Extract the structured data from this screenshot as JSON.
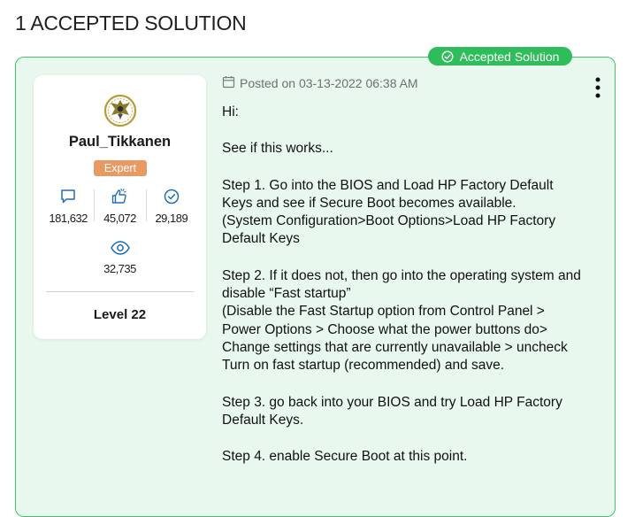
{
  "section": {
    "heading": "1 ACCEPTED SOLUTION"
  },
  "badge": {
    "label": "Accepted Solution",
    "icon": "check-circle-icon",
    "color": "#2ebd5a"
  },
  "colors": {
    "card_bg": "#e8f8ef",
    "card_border": "#3ec367",
    "rank_bg": "#e89a63"
  },
  "author": {
    "username": "Paul_Tikkanen",
    "avatar": "eagle-emblem-avatar",
    "rank": "Expert",
    "stats": [
      {
        "icon": "message-icon",
        "value": "181,632"
      },
      {
        "icon": "kudos-thumbs-up-icon",
        "value": "45,072"
      },
      {
        "icon": "check-circle-icon",
        "value": "29,189"
      }
    ],
    "views": {
      "icon": "eye-icon",
      "value": "32,735"
    },
    "level": "Level 22"
  },
  "post": {
    "posted": "Posted on 03-13-2022 06:38 AM",
    "menu_icon": "more-vertical-icon",
    "paragraphs": [
      "Hi:",
      "See if this works...",
      "Step 1. Go into the BIOS and Load HP Factory Default Keys and see if Secure Boot becomes available.\n(System Configuration>Boot Options>Load HP Factory Default Keys",
      "Step 2. If it does not, then go into the operating system and disable “Fast startup”\n(Disable the Fast Startup option from Control Panel > Power Options > Choose what the power buttons do> Change settings that are currently unavailable > uncheck Turn on fast startup (recommended) and save.",
      "Step 3. go back into your BIOS and try Load HP Factory Default Keys.",
      "Step 4. enable Secure Boot at this point."
    ]
  }
}
